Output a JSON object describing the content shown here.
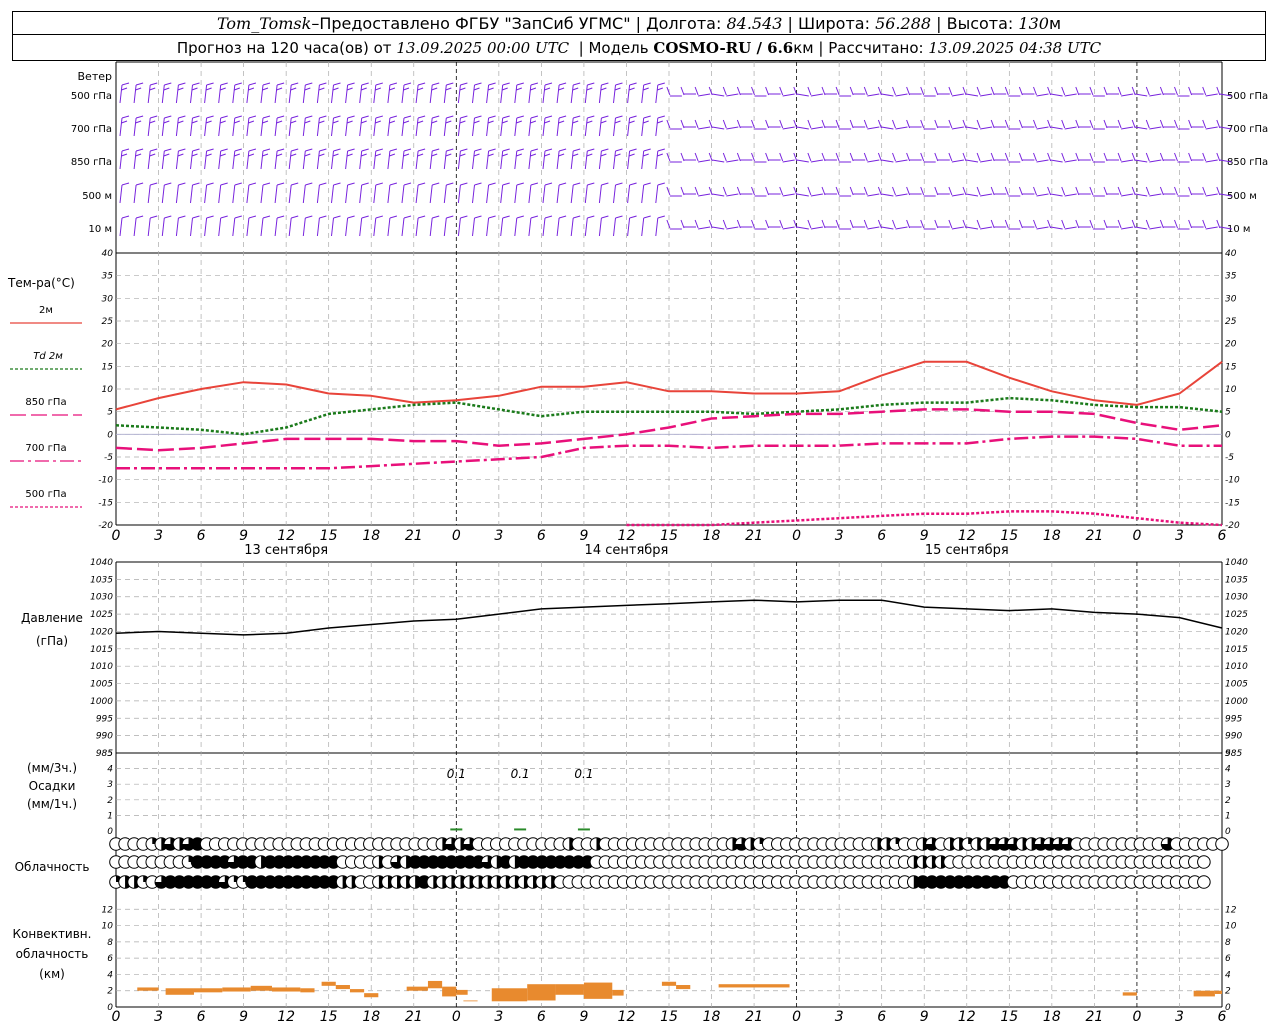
{
  "header": {
    "station": "Tom_Tomsk",
    "dash": " – ",
    "provided": "Предоставлено ФГБУ \"ЗапСиб УГМС\"",
    "lon_label": "Долгота:",
    "lon": "84.543",
    "lat_label": "Широта:",
    "lat": "56.288",
    "alt_label": "Высота:",
    "alt": "130",
    "alt_unit": "м",
    "forecast_label": "Прогноз на 120 часа(ов) от",
    "issued": "13.09.2025 00:00 UTC",
    "model_label": "Модель",
    "model": "COSMO-RU / 6.6",
    "model_unit": "км",
    "calc_label": "Рассчитано:",
    "calculated": "13.09.2025 04:38 UTC"
  },
  "labels": {
    "wind": "Ветер",
    "wind_levels": [
      "500 гПа",
      "700 гПа",
      "850 гПа",
      "500 м",
      "10 м"
    ],
    "temp_title": "Тем-ра(°C)",
    "temp_legend": [
      "2м",
      "Td 2м",
      "850 гПа",
      "700 гПа",
      "500 гПа"
    ],
    "pressure": "Давление",
    "pressure_unit": "(гПа)",
    "precip_unit3": "(мм/3ч.)",
    "precip": "Осадки",
    "precip_unit1": "(мм/1ч.)",
    "cloud": "Облачность",
    "conv1": "Конвективн.",
    "conv2": "облачность",
    "conv3": "(км)",
    "days": [
      "13 сентября",
      "14 сентября",
      "15 сентября"
    ],
    "precip_annotations": [
      "0.1",
      "0.1",
      "0.1"
    ]
  },
  "chart_data": [
    {
      "type": "line",
      "id": "temperature",
      "title": "Тем-ра(°C)",
      "ylim": [
        -20,
        40
      ],
      "yticks": [
        -20,
        -15,
        -10,
        -5,
        0,
        5,
        10,
        15,
        20,
        25,
        30,
        35,
        40
      ],
      "xticks": [
        "0",
        "3",
        "6",
        "9",
        "12",
        "15",
        "18",
        "21",
        "0",
        "3",
        "6",
        "9",
        "12",
        "15",
        "18",
        "21",
        "0",
        "3",
        "6",
        "9",
        "12",
        "15",
        "18",
        "21",
        "0",
        "3",
        "6"
      ],
      "x_hours": [
        0,
        3,
        6,
        9,
        12,
        15,
        18,
        21,
        24,
        27,
        30,
        33,
        36,
        39,
        42,
        45,
        48,
        51,
        54,
        57,
        60,
        63,
        66,
        69,
        72,
        75,
        78
      ],
      "series": [
        {
          "name": "2м",
          "color": "#e8443a",
          "values": [
            5.5,
            8,
            10,
            11.5,
            11,
            9,
            8.5,
            7,
            7.5,
            8.5,
            10.5,
            10.5,
            11.5,
            9.5,
            9.5,
            9,
            9,
            9.5,
            13,
            16,
            16,
            12.5,
            9.5,
            7.5,
            6.5,
            9,
            16
          ]
        },
        {
          "name": "Td 2м",
          "color": "#1a7a1a",
          "values": [
            2,
            1.5,
            1,
            0,
            1.5,
            4.5,
            5.5,
            6.5,
            7,
            5.5,
            4,
            5,
            5,
            5,
            5,
            4.5,
            5,
            5.5,
            6.5,
            7,
            7,
            8,
            7.5,
            6.5,
            6,
            6,
            5
          ]
        },
        {
          "name": "850 гПа",
          "color": "#e8107a",
          "values": [
            -3,
            -3.5,
            -3,
            -2,
            -1,
            -1,
            -1,
            -1.5,
            -1.5,
            -2.5,
            -2,
            -1,
            0,
            1.5,
            3.5,
            4,
            4.5,
            4.5,
            5,
            5.5,
            5.5,
            5,
            5,
            4.5,
            2.5,
            1,
            2
          ]
        },
        {
          "name": "700 гПа",
          "color": "#e8107a",
          "values": [
            -7.5,
            -7.5,
            -7.5,
            -7.5,
            -7.5,
            -7.5,
            -7,
            -6.5,
            -6,
            -5.5,
            -5,
            -3,
            -2.5,
            -2.5,
            -3,
            -2.5,
            -2.5,
            -2.5,
            -2,
            -2,
            -2,
            -1,
            -0.5,
            -0.5,
            -1,
            -2.5,
            -2.5
          ]
        },
        {
          "name": "500 гПа",
          "color": "#e8107a",
          "values": [
            null,
            null,
            null,
            null,
            null,
            null,
            null,
            null,
            null,
            null,
            null,
            null,
            -20,
            -20,
            -20,
            -19.5,
            -19,
            -18.5,
            -18,
            -17.5,
            -17.5,
            -17,
            -17,
            -17.5,
            -18.5,
            -19.5,
            -20
          ]
        }
      ]
    },
    {
      "type": "line",
      "id": "pressure",
      "title": "Давление",
      "ylabel": "(гПа)",
      "ylim": [
        985,
        1040
      ],
      "yticks": [
        985,
        990,
        995,
        1000,
        1005,
        1010,
        1015,
        1020,
        1025,
        1030,
        1035,
        1040
      ],
      "series": [
        {
          "name": "",
          "color": "#000000",
          "values": [
            1019.5,
            1020,
            1019.5,
            1019,
            1019.5,
            1021,
            1022,
            1023,
            1023.5,
            1025,
            1026.5,
            1027,
            1027.5,
            1028,
            1028.5,
            1029,
            1028.5,
            1029,
            1029,
            1027,
            1026.5,
            1026,
            1026.5,
            1025.5,
            1025,
            1024,
            1021
          ]
        }
      ]
    },
    {
      "type": "bar",
      "id": "precip",
      "ylim": [
        0,
        5
      ],
      "yticks": [
        0,
        1,
        2,
        3,
        4,
        5
      ],
      "x_hours": [
        24,
        28.5,
        33
      ],
      "values": [
        0.1,
        0.1,
        0.1
      ]
    },
    {
      "type": "table",
      "id": "cloud",
      "rows": 3,
      "values": [
        [
          0,
          0,
          0,
          0,
          1,
          2,
          3,
          2,
          3,
          4,
          0,
          0,
          0,
          0,
          0,
          0,
          0,
          0,
          0,
          0,
          0,
          0,
          0,
          0,
          0,
          0,
          0,
          0,
          0,
          0,
          0,
          0,
          0,
          0,
          0,
          0,
          2,
          3,
          2,
          3,
          0,
          0,
          0,
          0,
          0,
          0,
          0,
          0,
          0,
          0,
          2,
          0,
          0,
          2,
          0,
          0,
          0,
          0,
          0,
          0,
          0,
          0,
          0,
          0,
          0,
          0,
          0,
          0,
          2,
          3,
          2,
          1,
          0,
          0,
          0,
          0,
          0,
          0,
          0,
          0,
          0,
          0,
          0,
          0,
          2,
          2,
          1,
          0,
          0,
          2,
          3,
          0,
          2,
          2,
          1,
          2,
          2,
          3,
          3,
          3,
          2,
          2,
          3,
          3,
          3,
          3,
          0,
          0,
          0,
          0,
          0,
          0,
          0,
          0,
          0,
          0,
          3,
          0,
          0,
          0,
          0,
          0,
          0
        ],
        [
          0,
          0,
          0,
          0,
          0,
          0,
          0,
          0,
          1,
          4,
          4,
          4,
          4,
          3,
          4,
          4,
          2,
          4,
          4,
          4,
          4,
          4,
          4,
          4,
          4,
          0,
          0,
          0,
          0,
          2,
          0,
          3,
          2,
          4,
          4,
          4,
          4,
          4,
          4,
          4,
          4,
          3,
          2,
          4,
          2,
          4,
          4,
          4,
          4,
          4,
          4,
          4,
          4,
          0,
          0,
          0,
          0,
          0,
          0,
          0,
          0,
          0,
          0,
          0,
          0,
          0,
          0,
          0,
          0,
          0,
          0,
          0,
          0,
          0,
          0,
          0,
          0,
          0,
          0,
          0,
          0,
          0,
          0,
          0,
          0,
          0,
          0,
          0,
          2,
          2,
          2,
          2,
          0,
          0,
          0,
          0,
          0,
          0,
          0,
          0,
          0,
          0,
          0,
          0,
          0,
          0,
          0,
          0,
          0,
          0,
          0,
          0,
          0,
          0,
          0,
          0,
          0,
          0,
          0,
          0,
          0
        ],
        [
          1,
          2,
          2,
          1,
          0,
          3,
          4,
          4,
          4,
          4,
          4,
          4,
          3,
          1,
          1,
          4,
          4,
          4,
          4,
          4,
          4,
          4,
          4,
          4,
          4,
          2,
          2,
          0,
          0,
          2,
          2,
          2,
          2,
          2,
          4,
          2,
          2,
          2,
          2,
          2,
          2,
          2,
          2,
          2,
          2,
          2,
          2,
          2,
          2,
          0,
          0,
          0,
          0,
          0,
          0,
          0,
          0,
          0,
          0,
          0,
          0,
          0,
          0,
          0,
          0,
          0,
          0,
          0,
          0,
          0,
          0,
          0,
          0,
          0,
          0,
          0,
          0,
          0,
          0,
          0,
          0,
          0,
          0,
          0,
          0,
          0,
          0,
          0,
          2,
          4,
          4,
          4,
          4,
          4,
          4,
          4,
          4,
          4,
          4,
          0,
          0,
          0,
          0,
          0,
          0,
          0,
          0,
          0,
          0,
          0,
          0,
          0,
          0,
          0,
          0,
          0,
          0,
          0,
          0,
          0,
          0
        ]
      ]
    },
    {
      "type": "bar",
      "id": "convective",
      "title": "Конвективн. облачность",
      "ylabel": "(км)",
      "ylim": [
        0,
        14
      ],
      "yticks": [
        0,
        2,
        4,
        6,
        8,
        10,
        12
      ],
      "segments": [
        [
          1.5,
          3,
          2,
          2.4
        ],
        [
          3.5,
          5.5,
          1.5,
          2.3
        ],
        [
          5.5,
          7.5,
          1.8,
          2.3
        ],
        [
          7.5,
          9.5,
          1.9,
          2.4
        ],
        [
          9.5,
          11,
          2,
          2.6
        ],
        [
          11,
          13,
          1.9,
          2.4
        ],
        [
          13,
          14,
          1.8,
          2.3
        ],
        [
          14.5,
          15.5,
          2.6,
          3.1
        ],
        [
          15.5,
          16.5,
          2.2,
          2.7
        ],
        [
          16.5,
          17.5,
          1.8,
          2.2
        ],
        [
          17.5,
          18.5,
          1.2,
          1.7
        ],
        [
          20.5,
          22,
          2,
          2.5
        ],
        [
          22,
          23,
          2.3,
          3.2
        ],
        [
          23,
          24,
          1.3,
          2.5
        ],
        [
          24,
          24.8,
          1.5,
          2.1
        ],
        [
          24.5,
          25.5,
          0.7,
          0.8
        ],
        [
          26.5,
          29,
          0.7,
          2.3
        ],
        [
          29,
          31,
          0.8,
          2.8
        ],
        [
          31,
          33,
          1.5,
          2.8
        ],
        [
          33,
          35,
          1,
          3
        ],
        [
          35,
          35.8,
          1.4,
          2.1
        ],
        [
          38.5,
          39.5,
          2.6,
          3.1
        ],
        [
          39.5,
          40.5,
          2.2,
          2.7
        ],
        [
          42.5,
          47.5,
          2.4,
          2.8
        ],
        [
          71,
          72,
          1.4,
          1.8
        ],
        [
          76,
          77.5,
          1.3,
          2
        ],
        [
          77.5,
          78,
          1.6,
          2
        ]
      ]
    }
  ]
}
